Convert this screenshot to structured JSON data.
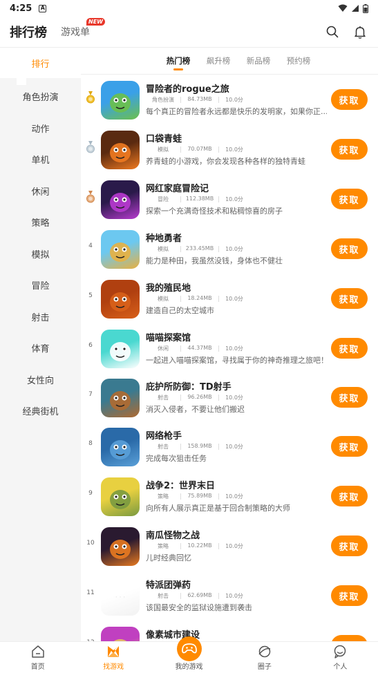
{
  "status": {
    "time": "4:25",
    "a_icon": "A"
  },
  "header": {
    "title": "排行榜",
    "tab2": "游戏单",
    "new_badge": "NEW"
  },
  "sidebar": {
    "items": [
      "排行",
      "角色扮演",
      "动作",
      "单机",
      "休闲",
      "策略",
      "模拟",
      "冒险",
      "射击",
      "体育",
      "女性向",
      "经典街机"
    ]
  },
  "subtabs": [
    "热门榜",
    "飙升榜",
    "新品榜",
    "预约榜"
  ],
  "button_label": "获取",
  "games": [
    {
      "rank": "1",
      "medal": "gold",
      "name": "冒险者的rogue之旅",
      "category": "角色扮演",
      "size": "84.73MB",
      "score": "10.0分",
      "desc": "每个真正的冒险者永远都是快乐的发明家，如果你正...",
      "icon": "knight-icon",
      "colors": [
        "#3aa0e8",
        "#6cc04a"
      ]
    },
    {
      "rank": "2",
      "medal": "silver",
      "name": "口袋青蛙",
      "category": "模拟",
      "size": "70.07MB",
      "score": "10.0分",
      "desc": "养青蛙的小游戏，你会发现各种各样的独特青蛙",
      "icon": "frog-icon",
      "colors": [
        "#5a2a10",
        "#f07a20"
      ]
    },
    {
      "rank": "3",
      "medal": "bronze",
      "name": "网红家庭冒险记",
      "category": "冒险",
      "size": "112.38MB",
      "score": "10.0分",
      "desc": "探索一个充满奇怪技术和粘稠惊喜的房子",
      "icon": "monster-icon",
      "colors": [
        "#2a1a4a",
        "#b83ad0"
      ]
    },
    {
      "rank": "4",
      "medal": "",
      "name": "种地勇者",
      "category": "模拟",
      "size": "233.45MB",
      "score": "10.0分",
      "desc": "能力是种田，我虽然没钱，身体也不健壮",
      "icon": "farmer-icon",
      "colors": [
        "#6cc8f0",
        "#e8b040"
      ]
    },
    {
      "rank": "5",
      "medal": "",
      "name": "我的殖民地",
      "category": "模拟",
      "size": "18.24MB",
      "score": "10.0分",
      "desc": "建造自己的太空城市",
      "icon": "rocket-icon",
      "colors": [
        "#b04010",
        "#d8601a"
      ]
    },
    {
      "rank": "6",
      "medal": "",
      "name": "喵喵探案馆",
      "category": "休闲",
      "size": "44.37MB",
      "score": "10.0分",
      "desc": "一起进入喵喵探案馆，寻找属于你的神奇推理之旅吧！",
      "icon": "cat-detective-icon",
      "colors": [
        "#4ad8d0",
        "#ffffff"
      ]
    },
    {
      "rank": "7",
      "medal": "",
      "name": "庇护所防御：TD射手",
      "category": "射击",
      "size": "96.26MB",
      "score": "10.0分",
      "desc": "消灭入侵者，不要让他们搬迟",
      "icon": "shooter-icon",
      "colors": [
        "#3a7a90",
        "#b06a30"
      ]
    },
    {
      "rank": "8",
      "medal": "",
      "name": "网络枪手",
      "category": "射击",
      "size": "158.9MB",
      "score": "10.0分",
      "desc": "完成每次狙击任务",
      "icon": "sniper-icon",
      "colors": [
        "#2a6aa8",
        "#5aa0d8"
      ]
    },
    {
      "rank": "9",
      "medal": "",
      "name": "战争2：世界末日",
      "category": "策略",
      "size": "75.89MB",
      "score": "10.0分",
      "desc": "向所有人展示真正是基于回合制策略的大师",
      "icon": "soldier-icon",
      "colors": [
        "#e8d040",
        "#7a9a40"
      ]
    },
    {
      "rank": "10",
      "medal": "",
      "name": "南瓜怪物之战",
      "category": "策略",
      "size": "10.22MB",
      "score": "10.0分",
      "desc": "儿时经典回忆",
      "icon": "pumpkin-icon",
      "colors": [
        "#2a1a30",
        "#e87a20"
      ]
    },
    {
      "rank": "11",
      "medal": "",
      "name": "特派团弹药",
      "category": "射击",
      "size": "62.69MB",
      "score": "10.0分",
      "desc": "该国最安全的监狱设施遭到袭击",
      "icon": "blank-icon",
      "colors": [
        "#ffffff",
        "#f2f2f2"
      ]
    },
    {
      "rank": "12",
      "medal": "",
      "name": "像素城市建设",
      "category": "",
      "size": "",
      "score": "",
      "desc": "",
      "icon": "pixel-city-icon",
      "colors": [
        "#c040c0",
        "#e8c060"
      ]
    }
  ],
  "bottom_nav": [
    "首页",
    "找游戏",
    "我的游戏",
    "圈子",
    "个人"
  ]
}
